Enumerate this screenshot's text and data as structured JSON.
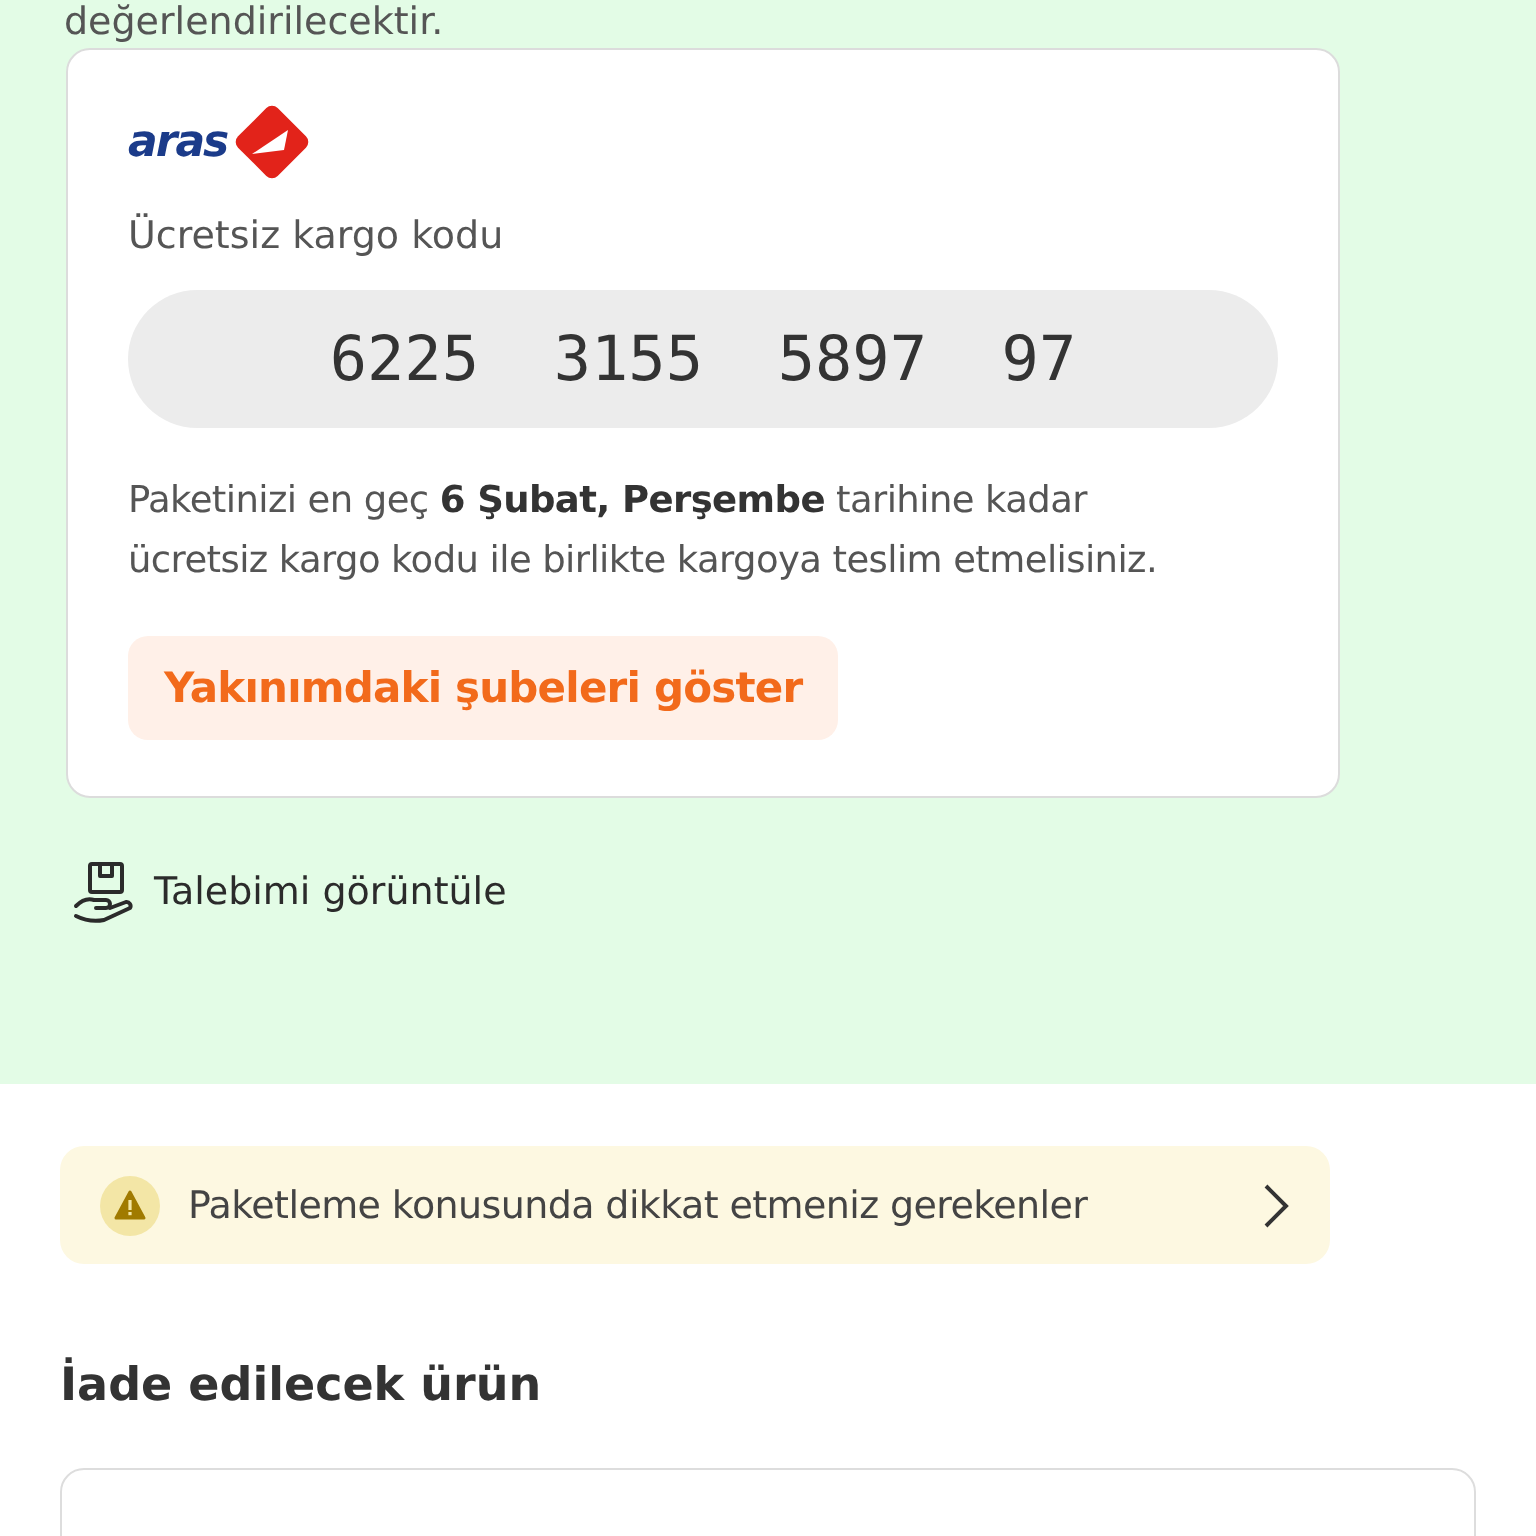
{
  "intro_text": "değerlendirilecektir.",
  "cargo_card": {
    "logo_text": "aras",
    "code_label": "Ücretsiz kargo kodu",
    "code": "6225  3155  5897  97",
    "instruction": "Paketinizi en geç **6 Şubat, Perşembe** tarihine kadar ücretsiz kargo kodu ile birlikte kargoya teslim etmelisiniz.",
    "branches_button": "Yakınımdaki şubeleri göster"
  },
  "view_request_link": "Talebimi görüntüle",
  "packaging_notice": "Paketleme konusunda dikkat etmeniz gerekenler",
  "returned_product_heading": "İade edilecek ürün"
}
